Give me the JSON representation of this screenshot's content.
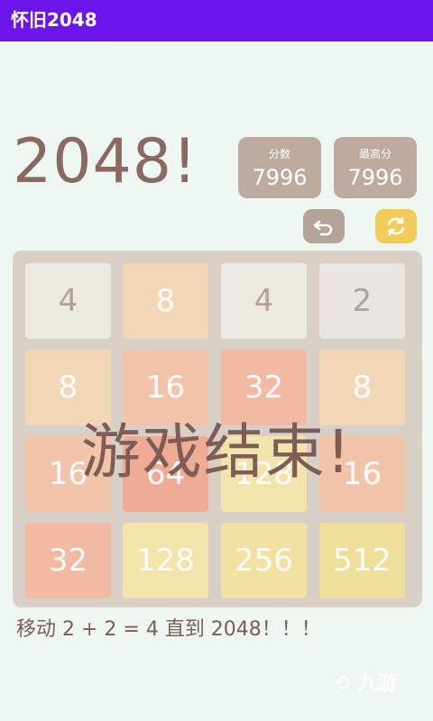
{
  "app": {
    "title": "怀旧2048"
  },
  "header": {
    "big_title": "2048!"
  },
  "scores": {
    "current": {
      "label": "分数",
      "value": "7996"
    },
    "best": {
      "label": "最高分",
      "value": "7996"
    }
  },
  "controls": {
    "undo_icon": "undo-icon",
    "restart_icon": "refresh-icon"
  },
  "board": {
    "rows": [
      [
        "4",
        "8",
        "4",
        "2"
      ],
      [
        "8",
        "16",
        "32",
        "8"
      ],
      [
        "16",
        "64",
        "128",
        "16"
      ],
      [
        "32",
        "128",
        "256",
        "512"
      ]
    ]
  },
  "overlay": {
    "message": "游戏结束!"
  },
  "footer": {
    "hint": "移动 2 + 2 = 4 直到 2048！！！"
  },
  "watermark": {
    "text": "九游"
  },
  "colors": {
    "appbar": "#6a16e8",
    "background": "#eef6f1",
    "board": "#cdbfb4",
    "tile_2": "#e6dfd8",
    "tile_4": "#ebe4db",
    "tile_8": "#f2c99a",
    "tile_16": "#f4ae86",
    "tile_32": "#f39d7e",
    "tile_64": "#ef8866",
    "tile_128": "#f3dd89",
    "tile_256": "#f3d97c",
    "tile_512": "#f1d56d"
  }
}
